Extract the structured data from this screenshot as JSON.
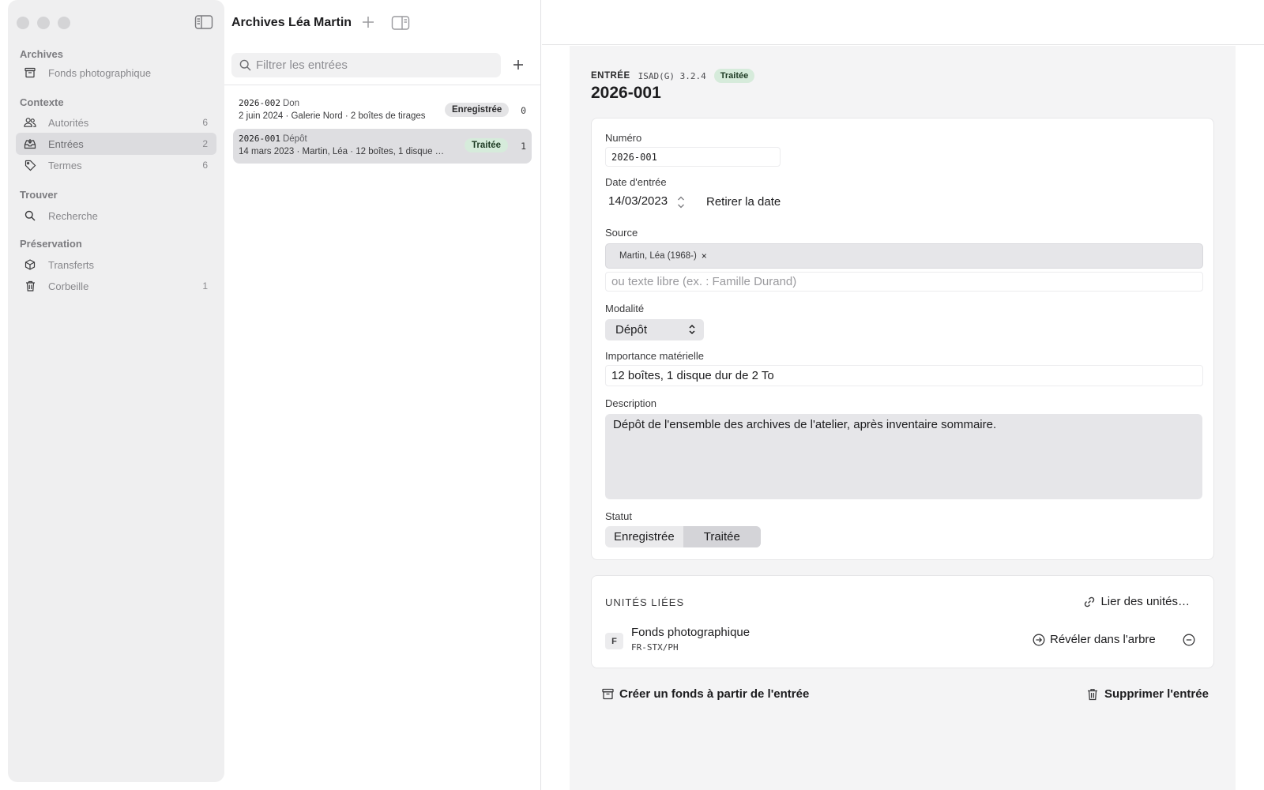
{
  "sidebar": {
    "sections": [
      {
        "title": "Archives",
        "items": [
          {
            "label": "Fonds photographique",
            "count": ""
          }
        ]
      },
      {
        "title": "Contexte",
        "items": [
          {
            "label": "Autorités",
            "count": "6"
          },
          {
            "label": "Entrées",
            "count": "2"
          },
          {
            "label": "Termes",
            "count": "6"
          }
        ]
      },
      {
        "title": "Trouver",
        "items": [
          {
            "label": "Recherche",
            "count": ""
          }
        ]
      },
      {
        "title": "Préservation",
        "items": [
          {
            "label": "Transferts",
            "count": ""
          },
          {
            "label": "Corbeille",
            "count": "1"
          }
        ]
      }
    ],
    "active_item": "Entrées"
  },
  "list": {
    "title": "Archives Léa Martin",
    "filter_placeholder": "Filtrer les entrées",
    "entries": [
      {
        "code": "2026-002",
        "modality": "Don",
        "subtitle": "2 juin 2024 · Galerie Nord · 2 boîtes de tirages",
        "status": "Enregistrée",
        "count": "0"
      },
      {
        "code": "2026-001",
        "modality": "Dépôt",
        "subtitle": "14 mars 2023 · Martin, Léa · 12 boîtes, 1 disque dur de 2 To",
        "status": "Traitée",
        "count": "1"
      }
    ]
  },
  "detail": {
    "kicker": "ENTRÉE",
    "standard": "ISAD(G) 3.2.4",
    "status_badge": "Traitée",
    "title": "2026-001",
    "form": {
      "numero_label": "Numéro",
      "numero_value": "2026-001",
      "date_label": "Date d'entrée",
      "date_value": "14/03/2023",
      "date_clear": "Retirer la date",
      "source_label": "Source",
      "source_token": "Martin, Léa (1968-)",
      "source_token_remove": "×",
      "source_free_placeholder": "ou texte libre (ex. : Famille Durand)",
      "modalite_label": "Modalité",
      "modalite_value": "Dépôt",
      "importance_label": "Importance matérielle",
      "importance_value": "12 boîtes, 1 disque dur de 2 To",
      "description_label": "Description",
      "description_value": "Dépôt de l'ensemble des archives de l'atelier, après inventaire sommaire.",
      "statut_label": "Statut",
      "statut_options": [
        "Enregistrée",
        "Traitée"
      ],
      "statut_selected": "Traitée"
    },
    "units": {
      "title": "UNITÉS LIÉES",
      "link_label": "Lier des unités…",
      "items": [
        {
          "badge": "F",
          "name": "Fonds photographique",
          "code": "FR-STX/PH",
          "reveal_label": "Révéler dans l'arbre"
        }
      ]
    },
    "actions": {
      "create_fonds": "Créer un fonds à partir de l'entrée",
      "delete": "Supprimer l'entrée"
    }
  },
  "icons": [
    "sidebar-toggle-icon",
    "plus-icon",
    "inspector-icon",
    "archive-box-icon",
    "people-icon",
    "tray-icon",
    "tag-icon",
    "search-icon",
    "cube-icon",
    "trash-icon",
    "link-icon",
    "arrow-circle-icon",
    "minus-circle-icon"
  ]
}
